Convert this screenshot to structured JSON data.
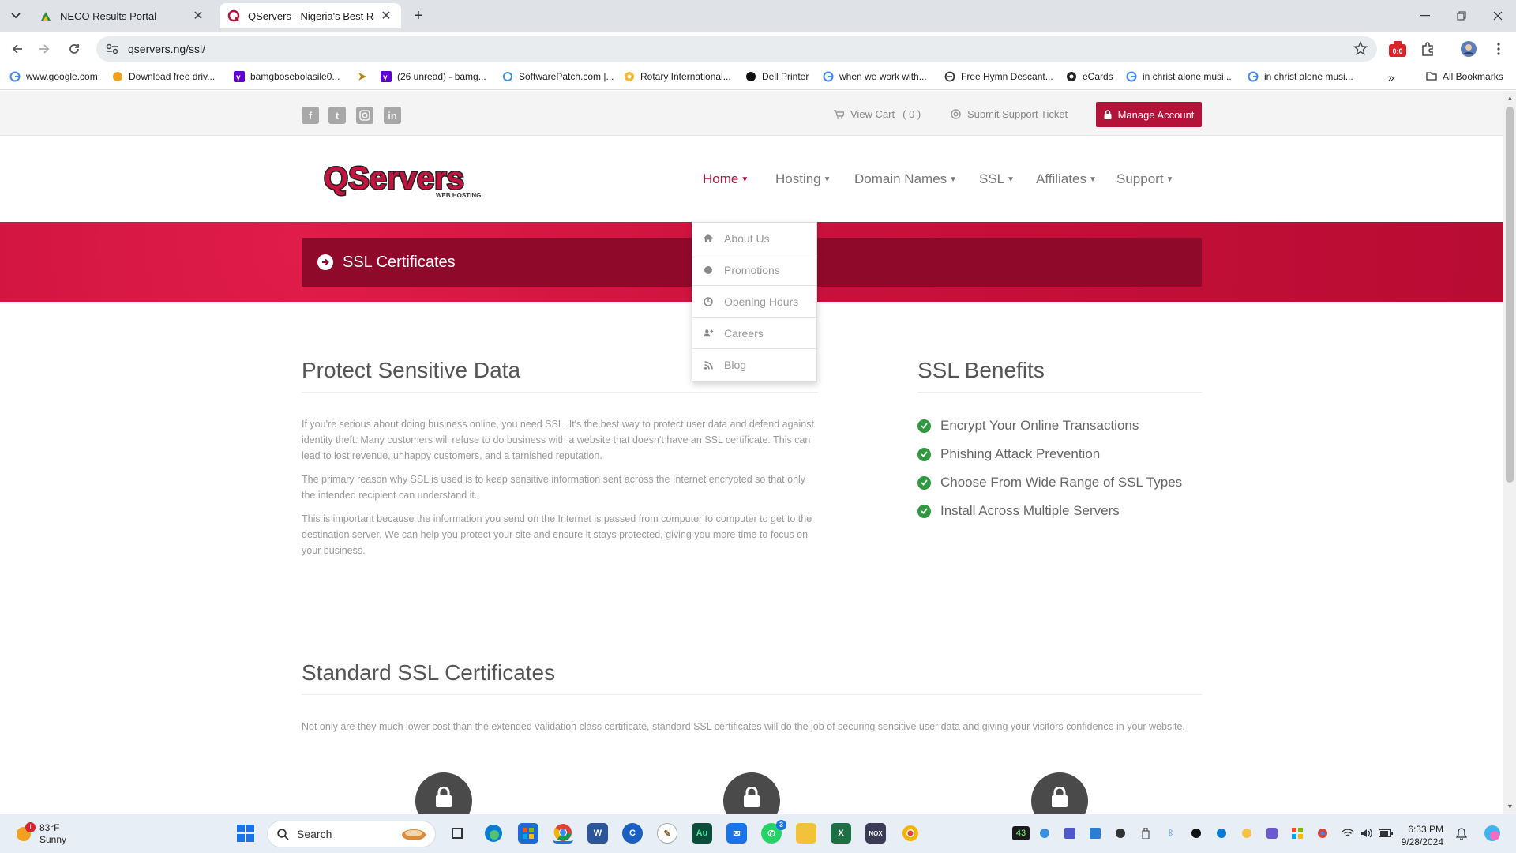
{
  "browser": {
    "tabs": [
      {
        "title": "NECO Results Portal",
        "active": false
      },
      {
        "title": "QServers - Nigeria's Best Rated",
        "active": true
      }
    ],
    "url": "qservers.ng/ssl/",
    "bookmarks": [
      {
        "label": "www.google.com",
        "icon": "google-icon"
      },
      {
        "label": "Download free driv...",
        "icon": "download-icon"
      },
      {
        "label": "bamgbosebolasile0...",
        "icon": "yahoo-icon"
      },
      {
        "label": "",
        "icon": "arrow-bookmark-icon"
      },
      {
        "label": "(26 unread) - bamg...",
        "icon": "yahoo-mail-icon"
      },
      {
        "label": "SoftwarePatch.com |...",
        "icon": "softwarepatch-icon"
      },
      {
        "label": "Rotary International...",
        "icon": "rotary-icon"
      },
      {
        "label": "Dell Printer",
        "icon": "dell-icon"
      },
      {
        "label": "when we work with...",
        "icon": "google-icon"
      },
      {
        "label": "Free Hymn Descant...",
        "icon": "globe-icon"
      },
      {
        "label": "eCards",
        "icon": "ecards-icon"
      },
      {
        "label": "in christ alone musi...",
        "icon": "google-icon"
      },
      {
        "label": "in christ alone musi...",
        "icon": "google-icon"
      }
    ],
    "all_bookmarks": "All Bookmarks",
    "extension_badge": "0:0"
  },
  "site": {
    "social": [
      "facebook-icon",
      "twitter-icon",
      "instagram-icon",
      "linkedin-icon"
    ],
    "view_cart": "View Cart",
    "cart_count": "( 0 )",
    "submit_ticket": "Submit Support Ticket",
    "manage_account": "Manage Account",
    "logo_text": "QServers",
    "logo_sub": "WEB HOSTING",
    "nav": [
      {
        "label": "Home",
        "active": true
      },
      {
        "label": "Hosting",
        "active": false
      },
      {
        "label": "Domain Names",
        "active": false
      },
      {
        "label": "SSL",
        "active": false
      },
      {
        "label": "Affiliates",
        "active": false
      },
      {
        "label": "Support",
        "active": false
      }
    ],
    "dropdown": [
      {
        "label": "About Us",
        "icon": "home-icon"
      },
      {
        "label": "Promotions",
        "icon": "star-icon"
      },
      {
        "label": "Opening Hours",
        "icon": "clock-icon"
      },
      {
        "label": "Careers",
        "icon": "users-icon"
      },
      {
        "label": "Blog",
        "icon": "rss-icon"
      }
    ],
    "banner_title": "SSL Certificates",
    "protect": {
      "heading": "Protect Sensitive Data",
      "paragraphs": [
        "If you're serious about doing business online, you need SSL. It's the best way to protect user data and defend against identity theft. Many customers will refuse to do business with a website that doesn't have an SSL certificate. This can lead to lost revenue, unhappy customers, and a tarnished reputation.",
        "The primary reason why SSL is used is to keep sensitive information sent across the Internet encrypted so that only the intended recipient can understand it.",
        "This is important because the information you send on the Internet is passed from computer to computer to get to the destination server. We can help you protect your site and ensure it stays protected, giving you more time to focus on your business."
      ]
    },
    "benefits": {
      "heading": "SSL Benefits",
      "items": [
        "Encrypt Your Online Transactions",
        "Phishing Attack Prevention",
        "Choose From Wide Range of SSL Types",
        "Install Across Multiple Servers"
      ]
    },
    "standard": {
      "heading": "Standard SSL Certificates",
      "text": "Not only are they much lower cost than the extended validation class certificate, standard SSL certificates will do the job of securing sensitive user data and giving your visitors confidence in your website."
    },
    "accent": "#b5123a"
  },
  "taskbar": {
    "weather_temp": "83°F",
    "weather_desc": "Sunny",
    "weather_badge": "1",
    "search_placeholder": "Search",
    "whatsapp_badge": "3",
    "tray_badge": "43",
    "time": "6:33 PM",
    "date": "9/28/2024"
  }
}
